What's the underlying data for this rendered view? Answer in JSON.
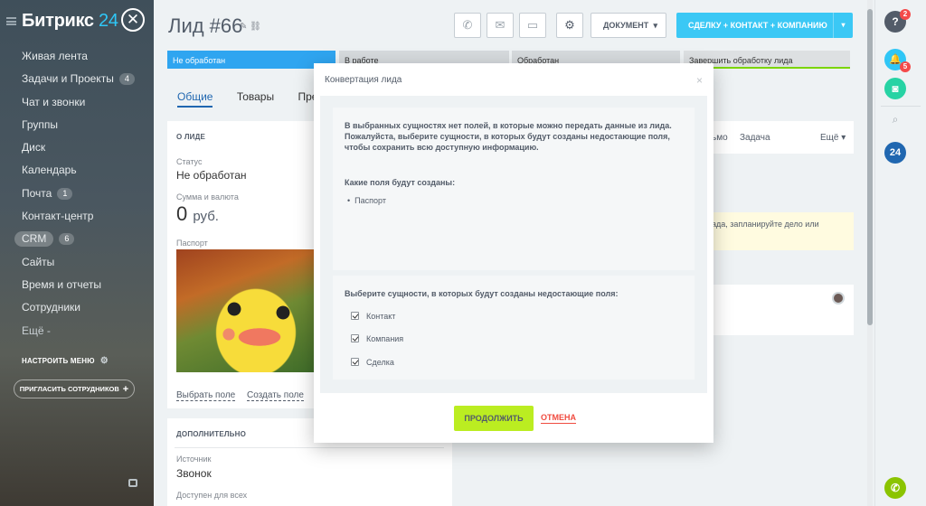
{
  "sidebar": {
    "logo_main": "Битрикс",
    "logo_num": "24",
    "close_symbol": "✕",
    "items": [
      {
        "label": "Живая лента",
        "count": ""
      },
      {
        "label": "Задачи и Проекты",
        "count": "4"
      },
      {
        "label": "Чат и звонки",
        "count": ""
      },
      {
        "label": "Группы",
        "count": ""
      },
      {
        "label": "Диск",
        "count": ""
      },
      {
        "label": "Календарь",
        "count": ""
      },
      {
        "label": "Почта",
        "count": "1"
      },
      {
        "label": "Контакт-центр",
        "count": ""
      },
      {
        "label": "CRM",
        "count": "6"
      },
      {
        "label": "Сайты",
        "count": ""
      },
      {
        "label": "Время и отчеты",
        "count": ""
      },
      {
        "label": "Сотрудники",
        "count": ""
      },
      {
        "label": "Ещё -",
        "count": ""
      }
    ],
    "settings_label": "НАСТРОИТЬ МЕНЮ",
    "invite_label": "ПРИГЛАСИТЬ СОТРУДНИКОВ"
  },
  "header": {
    "title": "Лид #66",
    "document_label": "ДОКУМЕНТ",
    "convert_label": "СДЕЛКУ + КОНТАКТ + КОМПАНИЮ"
  },
  "stages": [
    "Не обработан",
    "В работе",
    "Обработан",
    "Завершить обработку лида"
  ],
  "tabs": [
    "Общие",
    "Товары",
    "Предл"
  ],
  "about": {
    "heading": "О ЛИДЕ",
    "status_label": "Статус",
    "status_value": "Не обработан",
    "sum_label": "Сумма и валюта",
    "sum_value": "0",
    "sum_currency": "руб.",
    "passport_label": "Паспорт",
    "select_field": "Выбрать поле",
    "create_field": "Создать поле"
  },
  "extra": {
    "heading": "ДОПОЛНИТЕЛЬНО",
    "source_label": "Источник",
    "source_value": "Звонок",
    "access_label": "Доступен для всех"
  },
  "right_card": {
    "tab_mail": "ьмо",
    "tab_task": "Задача",
    "more": "Ещё",
    "hint": "ада, запланируйте дело или"
  },
  "right_panel": {
    "help_badge": "2",
    "bell_badge": "5",
    "b24": "24"
  },
  "modal": {
    "title": "Конвертация лида",
    "message": "В выбранных сущностях нет полей, в которые можно передать данные из лида. Пожалуйста, выберите сущности, в которых будут созданы недостающие поля, чтобы сохранить всю доступную информацию.",
    "fields_heading": "Какие поля будут созданы:",
    "fields": [
      "Паспорт"
    ],
    "entities_heading": "Выберите сущности, в которых будут созданы недостающие поля:",
    "entities": [
      "Контакт",
      "Компания",
      "Сделка"
    ],
    "continue_label": "ПРОДОЛЖИТЬ",
    "cancel_label": "ОТМЕНА"
  },
  "colors": {
    "accent": "#3bc8f5",
    "stage_active": "#2fa5f0",
    "continue": "#bbed21",
    "cancel": "#f04b3f"
  }
}
